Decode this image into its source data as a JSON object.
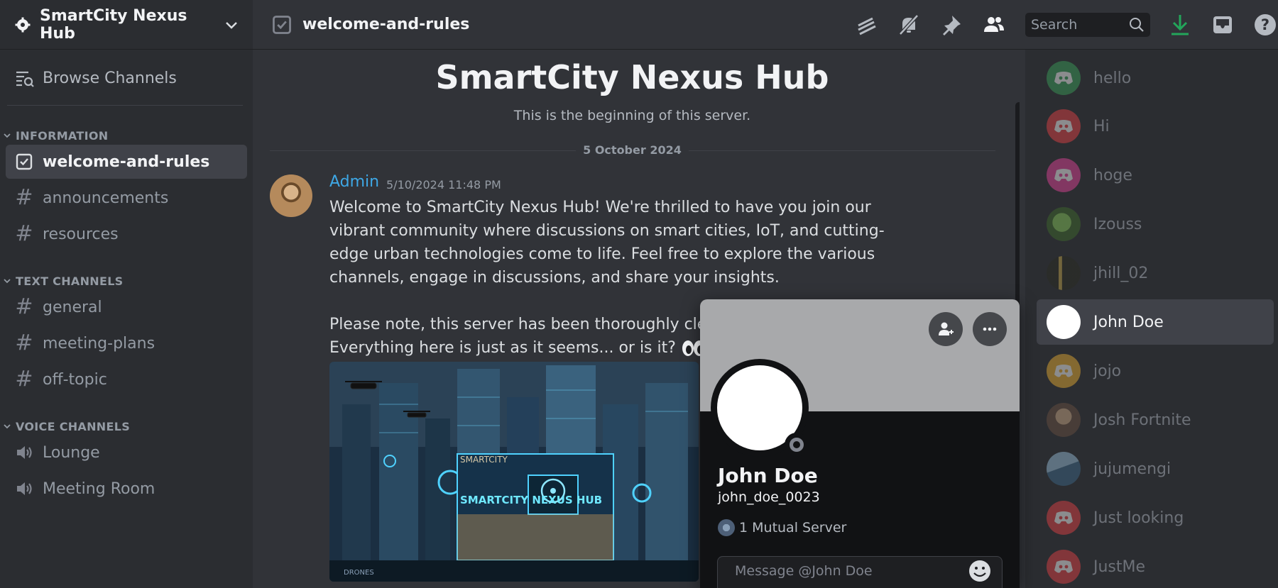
{
  "server": {
    "name": "SmartCity Nexus Hub"
  },
  "sidebar": {
    "browse_label": "Browse Channels",
    "categories": [
      {
        "label": "INFORMATION",
        "channels": [
          {
            "label": "welcome-and-rules",
            "icon": "rules-icon",
            "active": true
          },
          {
            "label": "announcements",
            "icon": "hash-icon"
          },
          {
            "label": "resources",
            "icon": "hash-icon"
          }
        ]
      },
      {
        "label": "TEXT CHANNELS",
        "channels": [
          {
            "label": "general",
            "icon": "hash-icon"
          },
          {
            "label": "meeting-plans",
            "icon": "hash-icon"
          },
          {
            "label": "off-topic",
            "icon": "hash-icon"
          }
        ]
      },
      {
        "label": "VOICE CHANNELS",
        "channels": [
          {
            "label": "Lounge",
            "icon": "speaker-icon"
          },
          {
            "label": "Meeting Room",
            "icon": "speaker-icon"
          }
        ]
      }
    ]
  },
  "topbar": {
    "channel_title": "welcome-and-rules",
    "search_placeholder": "Search",
    "accent_download": "#23a55a"
  },
  "chat": {
    "welcome_title": "SmartCity Nexus Hub",
    "welcome_sub": "This is the beginning of this server.",
    "date_divider": "5 October 2024",
    "message": {
      "author": "Admin",
      "timestamp": "5/10/2024 11:48 PM",
      "text_1": "Welcome to SmartCity Nexus Hub! We're thrilled to have you join our vibrant community where discussions on smart cities, IoT, and cutting-edge urban technologies come to life. Feel free to explore the various channels, engage in discussions, and share your insights.",
      "text_2": "Please note, this server has been thoroughly cleared",
      "text_3": "Everything here is just as it seems... or is it?",
      "image_sign_1": "SMARTCITY",
      "image_sign_2": "SMARTCITY  NEXUS HUB",
      "image_sign_3": "DRONES"
    }
  },
  "members": [
    {
      "name": "hello",
      "color": "#3ba55c"
    },
    {
      "name": "Hi",
      "color": "#ed4245"
    },
    {
      "name": "hoge",
      "color": "#eb459e"
    },
    {
      "name": "Izouss",
      "color": "#4a8a3a"
    },
    {
      "name": "jhill_02",
      "color": "#5a5030"
    },
    {
      "name": "John Doe",
      "color": "#ffffff",
      "active": true
    },
    {
      "name": "jojo",
      "color": "#f0b232"
    },
    {
      "name": "Josh Fortnite",
      "color": "#8a6a50"
    },
    {
      "name": "jujumengi",
      "color": "#4a7aa0"
    },
    {
      "name": "Just looking",
      "color": "#ed4245"
    },
    {
      "name": "JustMe",
      "color": "#ed4245"
    }
  ],
  "profile": {
    "display_name": "John Doe",
    "username": "john_doe_0023",
    "mutual": "1 Mutual Server",
    "message_placeholder": "Message @John Doe"
  }
}
